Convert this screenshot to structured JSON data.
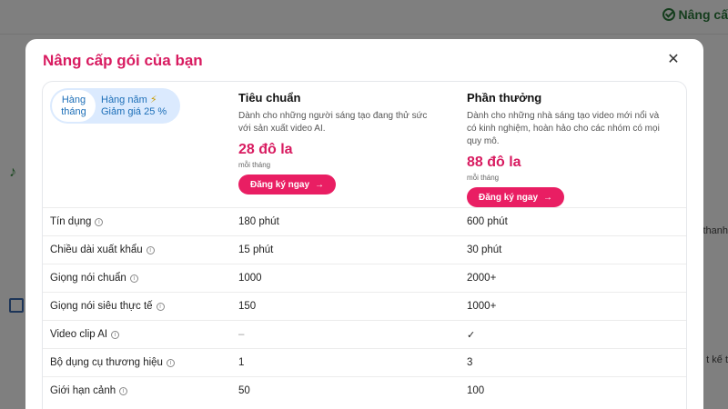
{
  "background": {
    "badge_label": "Nâng cấ",
    "right_text_1": "thanh",
    "right_text_2": "t kế t"
  },
  "modal": {
    "title": "Nâng cấp gói của bạn",
    "close_icon": "close-icon"
  },
  "billing": {
    "monthly_label": "Hàng tháng",
    "yearly_label": "Hàng năm",
    "yearly_discount": "Giảm giá 25 %",
    "bolt_icon": "bolt-icon"
  },
  "plans": [
    {
      "name": "Tiêu chuẩn",
      "description": "Dành cho những người sáng tạo đang thử sức với sản xuất video AI.",
      "price": "28 đô la",
      "period": "mỗi tháng",
      "button_label": "Đăng ký ngay"
    },
    {
      "name": "Phần thưởng",
      "description": "Dành cho những nhà sáng tạo video mới nổi và có kinh nghiệm, hoàn hảo cho các nhóm có mọi quy mô.",
      "price": "88 đô la",
      "period": "mỗi tháng",
      "button_label": "Đăng ký ngay"
    }
  ],
  "features": [
    {
      "name": "Tín dụng",
      "standard": "180 phút",
      "premium": "600 phút"
    },
    {
      "name": "Chiều dài xuất khẩu",
      "standard": "15 phút",
      "premium": "30 phút"
    },
    {
      "name": "Giọng nói chuẩn",
      "standard": "1000",
      "premium": "2000+"
    },
    {
      "name": "Giọng nói siêu thực tế",
      "standard": "150",
      "premium": "1000+"
    },
    {
      "name": "Video clip AI",
      "standard": "–",
      "premium": "✓"
    },
    {
      "name": "Bộ dụng cụ thương hiệu",
      "standard": "1",
      "premium": "3"
    },
    {
      "name": "Giới hạn cảnh",
      "standard": "50",
      "premium": "100"
    }
  ],
  "colors": {
    "accent": "#e91e63",
    "title": "#d81b60",
    "toggle_bg": "#dbeafe",
    "toggle_text": "#1d6fb8"
  }
}
